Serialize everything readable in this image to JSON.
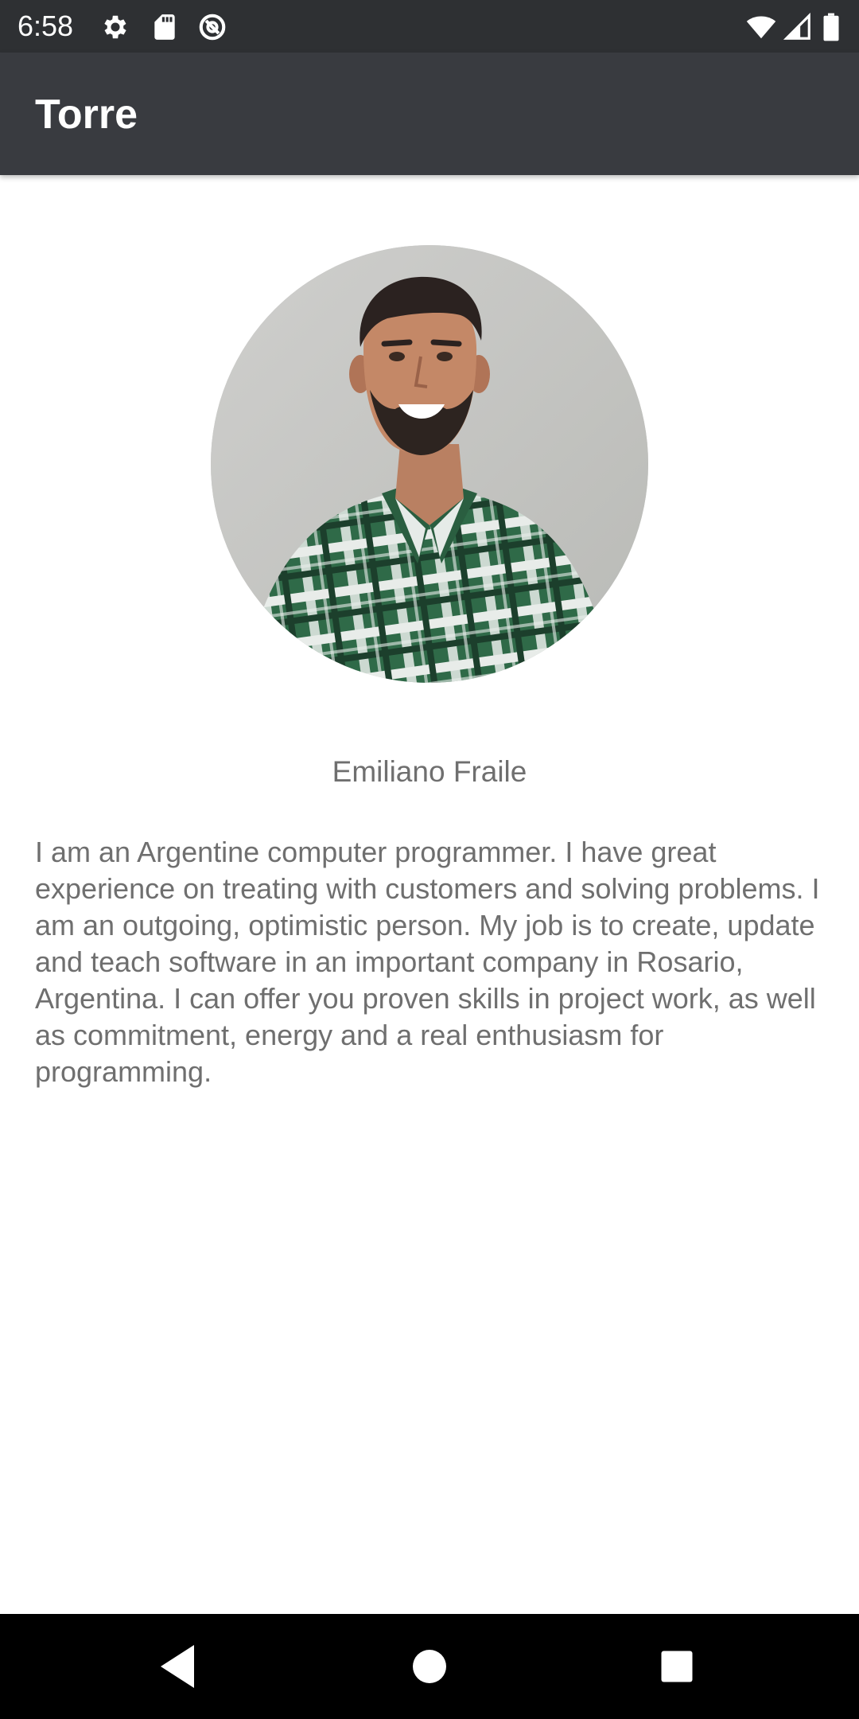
{
  "status_bar": {
    "time": "6:58",
    "left_icons": [
      "settings-icon",
      "sd-card-icon",
      "vpn-key-icon"
    ],
    "right_icons": [
      "wifi-icon",
      "cell-signal-icon",
      "battery-icon"
    ]
  },
  "app_bar": {
    "title": "Torre"
  },
  "profile": {
    "name": "Emiliano Fraile",
    "bio": "I am an Argentine computer programmer. I have great experience on treating with customers and solving problems. I am an outgoing, optimistic person. My job is to create, update and teach software in an important company in Rosario, Argentina. I can offer you proven skills in project work, as well as commitment, energy and a real enthusiasm for programming."
  },
  "nav_bar": {
    "buttons": [
      "back-icon",
      "home-icon",
      "recents-icon"
    ]
  },
  "colors": {
    "status_bar": "#2e3033",
    "app_bar": "#393b40",
    "text_secondary": "#6f6f6f",
    "nav_bar": "#000000"
  }
}
